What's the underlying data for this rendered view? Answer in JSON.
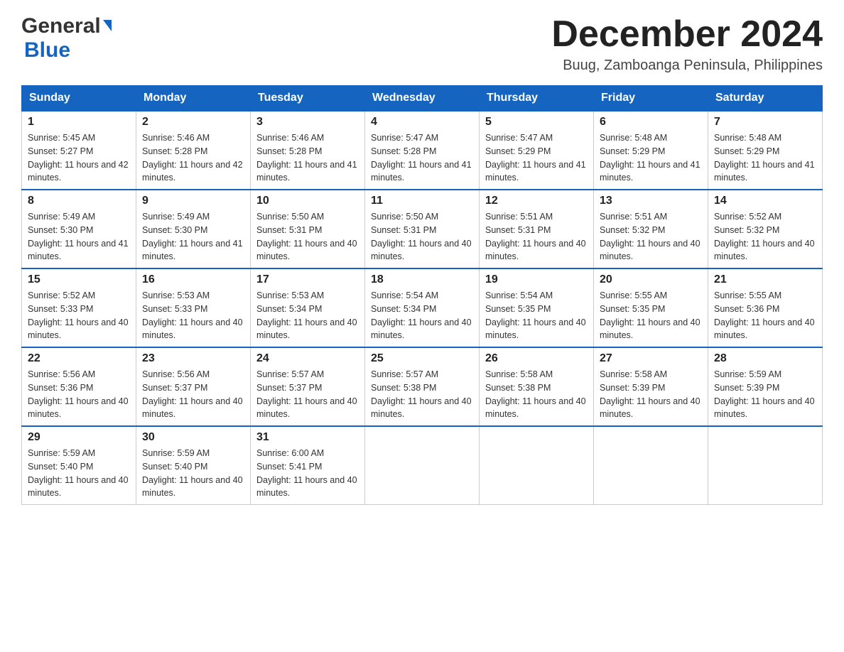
{
  "header": {
    "logo_line1": "General",
    "logo_line2": "Blue",
    "month_title": "December 2024",
    "location": "Buug, Zamboanga Peninsula, Philippines"
  },
  "days_of_week": [
    "Sunday",
    "Monday",
    "Tuesday",
    "Wednesday",
    "Thursday",
    "Friday",
    "Saturday"
  ],
  "weeks": [
    [
      {
        "day": "1",
        "sunrise": "5:45 AM",
        "sunset": "5:27 PM",
        "daylight": "11 hours and 42 minutes."
      },
      {
        "day": "2",
        "sunrise": "5:46 AM",
        "sunset": "5:28 PM",
        "daylight": "11 hours and 42 minutes."
      },
      {
        "day": "3",
        "sunrise": "5:46 AM",
        "sunset": "5:28 PM",
        "daylight": "11 hours and 41 minutes."
      },
      {
        "day": "4",
        "sunrise": "5:47 AM",
        "sunset": "5:28 PM",
        "daylight": "11 hours and 41 minutes."
      },
      {
        "day": "5",
        "sunrise": "5:47 AM",
        "sunset": "5:29 PM",
        "daylight": "11 hours and 41 minutes."
      },
      {
        "day": "6",
        "sunrise": "5:48 AM",
        "sunset": "5:29 PM",
        "daylight": "11 hours and 41 minutes."
      },
      {
        "day": "7",
        "sunrise": "5:48 AM",
        "sunset": "5:29 PM",
        "daylight": "11 hours and 41 minutes."
      }
    ],
    [
      {
        "day": "8",
        "sunrise": "5:49 AM",
        "sunset": "5:30 PM",
        "daylight": "11 hours and 41 minutes."
      },
      {
        "day": "9",
        "sunrise": "5:49 AM",
        "sunset": "5:30 PM",
        "daylight": "11 hours and 41 minutes."
      },
      {
        "day": "10",
        "sunrise": "5:50 AM",
        "sunset": "5:31 PM",
        "daylight": "11 hours and 40 minutes."
      },
      {
        "day": "11",
        "sunrise": "5:50 AM",
        "sunset": "5:31 PM",
        "daylight": "11 hours and 40 minutes."
      },
      {
        "day": "12",
        "sunrise": "5:51 AM",
        "sunset": "5:31 PM",
        "daylight": "11 hours and 40 minutes."
      },
      {
        "day": "13",
        "sunrise": "5:51 AM",
        "sunset": "5:32 PM",
        "daylight": "11 hours and 40 minutes."
      },
      {
        "day": "14",
        "sunrise": "5:52 AM",
        "sunset": "5:32 PM",
        "daylight": "11 hours and 40 minutes."
      }
    ],
    [
      {
        "day": "15",
        "sunrise": "5:52 AM",
        "sunset": "5:33 PM",
        "daylight": "11 hours and 40 minutes."
      },
      {
        "day": "16",
        "sunrise": "5:53 AM",
        "sunset": "5:33 PM",
        "daylight": "11 hours and 40 minutes."
      },
      {
        "day": "17",
        "sunrise": "5:53 AM",
        "sunset": "5:34 PM",
        "daylight": "11 hours and 40 minutes."
      },
      {
        "day": "18",
        "sunrise": "5:54 AM",
        "sunset": "5:34 PM",
        "daylight": "11 hours and 40 minutes."
      },
      {
        "day": "19",
        "sunrise": "5:54 AM",
        "sunset": "5:35 PM",
        "daylight": "11 hours and 40 minutes."
      },
      {
        "day": "20",
        "sunrise": "5:55 AM",
        "sunset": "5:35 PM",
        "daylight": "11 hours and 40 minutes."
      },
      {
        "day": "21",
        "sunrise": "5:55 AM",
        "sunset": "5:36 PM",
        "daylight": "11 hours and 40 minutes."
      }
    ],
    [
      {
        "day": "22",
        "sunrise": "5:56 AM",
        "sunset": "5:36 PM",
        "daylight": "11 hours and 40 minutes."
      },
      {
        "day": "23",
        "sunrise": "5:56 AM",
        "sunset": "5:37 PM",
        "daylight": "11 hours and 40 minutes."
      },
      {
        "day": "24",
        "sunrise": "5:57 AM",
        "sunset": "5:37 PM",
        "daylight": "11 hours and 40 minutes."
      },
      {
        "day": "25",
        "sunrise": "5:57 AM",
        "sunset": "5:38 PM",
        "daylight": "11 hours and 40 minutes."
      },
      {
        "day": "26",
        "sunrise": "5:58 AM",
        "sunset": "5:38 PM",
        "daylight": "11 hours and 40 minutes."
      },
      {
        "day": "27",
        "sunrise": "5:58 AM",
        "sunset": "5:39 PM",
        "daylight": "11 hours and 40 minutes."
      },
      {
        "day": "28",
        "sunrise": "5:59 AM",
        "sunset": "5:39 PM",
        "daylight": "11 hours and 40 minutes."
      }
    ],
    [
      {
        "day": "29",
        "sunrise": "5:59 AM",
        "sunset": "5:40 PM",
        "daylight": "11 hours and 40 minutes."
      },
      {
        "day": "30",
        "sunrise": "5:59 AM",
        "sunset": "5:40 PM",
        "daylight": "11 hours and 40 minutes."
      },
      {
        "day": "31",
        "sunrise": "6:00 AM",
        "sunset": "5:41 PM",
        "daylight": "11 hours and 40 minutes."
      },
      null,
      null,
      null,
      null
    ]
  ],
  "labels": {
    "sunrise_prefix": "Sunrise: ",
    "sunset_prefix": "Sunset: ",
    "daylight_prefix": "Daylight: "
  }
}
